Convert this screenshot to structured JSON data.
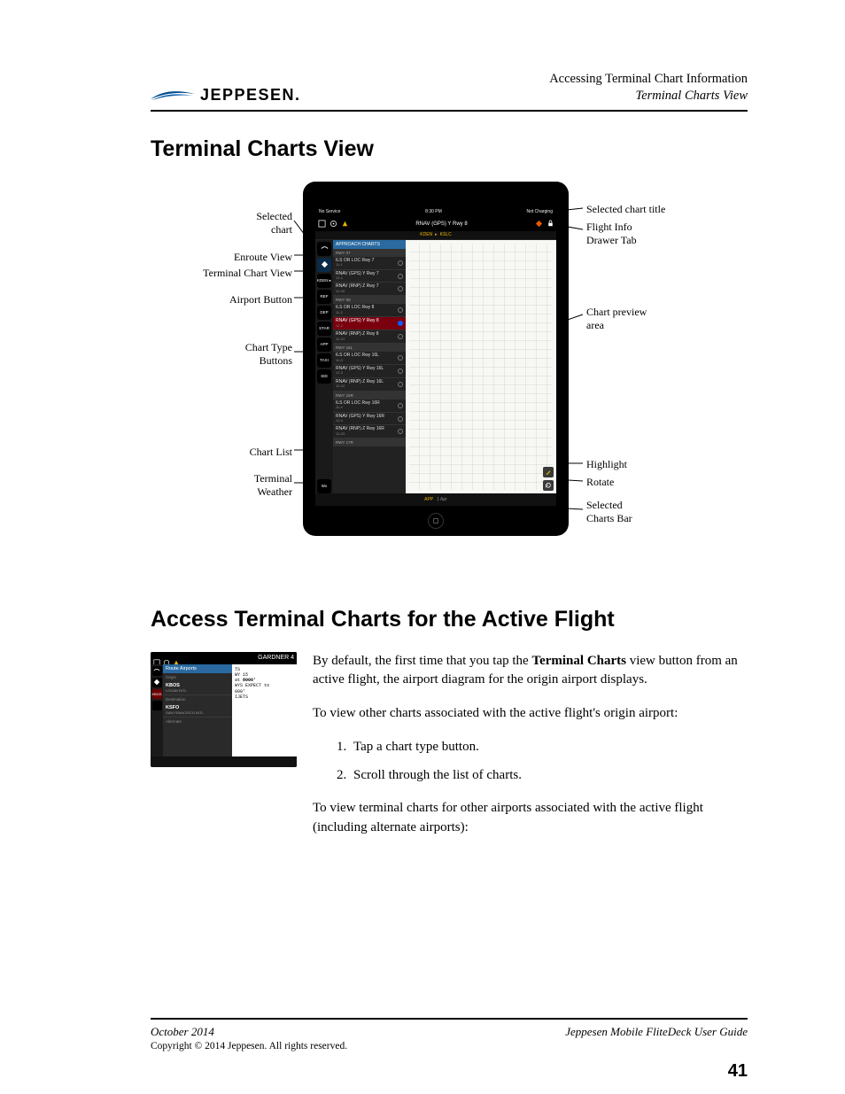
{
  "header": {
    "logo_text": "JEPPESEN.",
    "right_line1": "Accessing Terminal Chart Information",
    "right_line2": "Terminal Charts View"
  },
  "section1_title": "Terminal Charts View",
  "section2_title": "Access Terminal Charts for the Active Flight",
  "figure": {
    "statusbar": {
      "left": "No Service",
      "center": "8:30 PM",
      "right": "Not Charging"
    },
    "topbar_title": "RNAV (GPS) Y Rwy 8",
    "breadcrumb": {
      "a": "KDEN",
      "arrow": "▸",
      "b": "KSLC"
    },
    "sidebar": {
      "airport_code": "KDEN ▸",
      "types": [
        "REF",
        "DEP",
        "STAR",
        "APP",
        "TAXI",
        "SID"
      ],
      "wx": "Wx"
    },
    "chartlist": {
      "header": "APPROACH CHARTS",
      "groups": [
        {
          "label": "RWY 07",
          "items": [
            {
              "title": "ILS OR LOC Rwy 7",
              "sub": "11-1"
            },
            {
              "title": "RNAV (GPS) Y Rwy 7",
              "sub": "12-1"
            },
            {
              "title": "RNAV (RNP) Z Rwy 7",
              "sub": "12-20"
            }
          ]
        },
        {
          "label": "RWY 08",
          "items": [
            {
              "title": "ILS OR LOC Rwy 8",
              "sub": "11-2"
            },
            {
              "title": "RNAV (GPS) Y Rwy 8",
              "sub": "12-2",
              "selected": true
            },
            {
              "title": "RNAV (RNP) Z Rwy 8",
              "sub": "12-21"
            }
          ]
        },
        {
          "label": "RWY 16L",
          "items": [
            {
              "title": "ILS OR LOC Rwy 16L",
              "sub": "11-3"
            },
            {
              "title": "RNAV (GPS) Y Rwy 16L",
              "sub": "12-3"
            },
            {
              "title": "RNAV (RNP) Z Rwy 16L",
              "sub": "12-22"
            }
          ]
        },
        {
          "label": "RWY 16R",
          "items": [
            {
              "title": "ILS OR LOC Rwy 16R",
              "sub": "11-4"
            },
            {
              "title": "RNAV (GPS) Y Rwy 16R",
              "sub": "12-4"
            },
            {
              "title": "RNAV (RNP) Z Rwy 16R",
              "sub": "12-23"
            }
          ]
        },
        {
          "label": "RWY 17R",
          "items": []
        }
      ]
    },
    "bottombar": {
      "label": "APP",
      "sub": "1 Apr"
    },
    "callouts": {
      "left": [
        "Selected chart",
        "Enroute View",
        "Terminal Chart View",
        "Airport Button",
        "Chart Type Buttons",
        "Chart List",
        "Terminal Weather"
      ],
      "right": [
        "Selected chart title",
        "Flight Info Drawer Tab",
        "Chart preview area",
        "Highlight",
        "Rotate",
        "Selected Charts Bar"
      ]
    }
  },
  "body": {
    "p1a": "By default, the first time that you tap the ",
    "p1_bold": "Terminal Charts",
    "p1b": " view button from an active flight, the airport diagram for the origin airport displays.",
    "p2": "To view other charts associated with the active flight's origin airport:",
    "ol": [
      "Tap a chart type button.",
      "Scroll through the list of charts."
    ],
    "p3": "To view terminal charts for other airports associated with the active flight (including alternate airports):"
  },
  "mini": {
    "title": "GARDNER 4",
    "list_header": "Route Airports",
    "groups": [
      {
        "label": "Origin",
        "code": "KBOS",
        "name": "LOGAN INTL"
      },
      {
        "label": "Destination",
        "code": "KSFO",
        "name": "SAN FRANCISCO INTL"
      },
      {
        "label": "Alternate",
        "code": "",
        "name": ""
      }
    ],
    "right_lines": [
      "TS",
      "WY 15",
      "at 8000'",
      "WYS EXPECT to",
      "000'",
      "IJETS"
    ],
    "side_label": "KBOS"
  },
  "footer": {
    "left": "October 2014",
    "right": "Jeppesen Mobile FliteDeck User Guide",
    "copy": "Copyright © 2014 Jeppesen. All rights reserved.",
    "page": "41"
  }
}
